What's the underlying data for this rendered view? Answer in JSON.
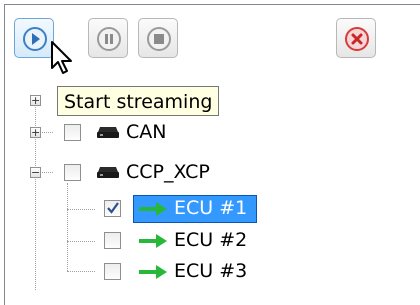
{
  "toolbar": {
    "play_icon": "play-icon",
    "pause_icon": "pause-icon",
    "stop_icon": "stop-icon",
    "close_icon": "close-icon",
    "tooltip": "Start streaming"
  },
  "tree": {
    "nodes": [
      {
        "label": "CAN",
        "icon": "bus-device-icon",
        "checked": false
      },
      {
        "label": "CCP_XCP",
        "icon": "bus-device-icon",
        "checked": false
      },
      {
        "label": "ECU #1",
        "icon": "green-arrow-icon",
        "checked": true,
        "selected": true
      },
      {
        "label": "ECU #2",
        "icon": "green-arrow-icon",
        "checked": false
      },
      {
        "label": "ECU #3",
        "icon": "green-arrow-icon",
        "checked": false
      }
    ]
  },
  "colors": {
    "selection": "#3399ff",
    "arrow": "#27b83a",
    "close_red": "#d93a3a",
    "tooltip_bg": "#ffffe1"
  }
}
